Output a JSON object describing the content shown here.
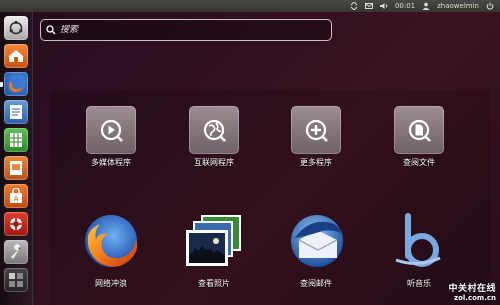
{
  "top_panel": {
    "clock": "00:01",
    "user": "zhaowelmin"
  },
  "search": {
    "placeholder": "搜索"
  },
  "categories": [
    {
      "label": "多媒体程序",
      "icon": "media-play-icon"
    },
    {
      "label": "互联网程序",
      "icon": "internet-globe-icon"
    },
    {
      "label": "更多程序",
      "icon": "more-apps-plus-icon"
    },
    {
      "label": "查阅文件",
      "icon": "files-document-icon"
    }
  ],
  "apps": [
    {
      "label": "网络冲浪",
      "icon": "firefox-icon"
    },
    {
      "label": "查看照片",
      "icon": "photos-icon"
    },
    {
      "label": "查阅邮件",
      "icon": "thunderbird-mail-icon"
    },
    {
      "label": "听音乐",
      "icon": "banshee-music-icon"
    }
  ],
  "watermark": {
    "line1": "中关村在线",
    "line2": "zol.com.cn"
  },
  "colors": {
    "panel": "#3f3d38",
    "launcher_accent": "#e05a1a",
    "firefox_orange": "#f47a1f",
    "thunderbird_blue": "#2a6fc4"
  }
}
